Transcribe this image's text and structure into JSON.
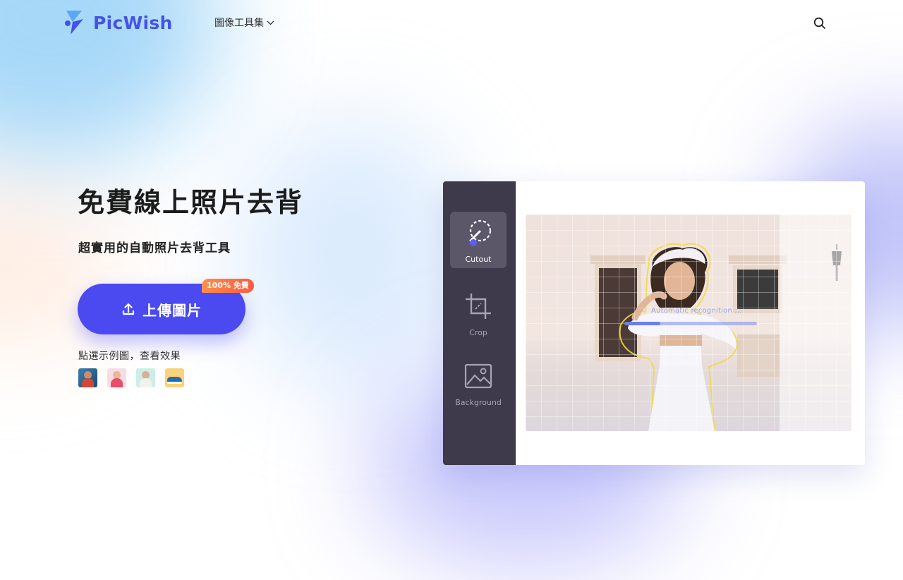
{
  "brand": {
    "name": "PicWish",
    "color": "#4352e8"
  },
  "nav": {
    "menu_label": "圖像工具集"
  },
  "hero": {
    "title": "免費線上照片去背",
    "subtitle": "超實用的自動照片去背工具",
    "upload_label": "上傳圖片",
    "badge": "100% 免費",
    "sample_label": "點選示例圖，查看效果",
    "samples": [
      "sample-portrait-1",
      "sample-portrait-2",
      "sample-portrait-3",
      "sample-shoe"
    ]
  },
  "editor": {
    "tools": [
      {
        "label": "Cutout",
        "icon": "cutout-icon",
        "active": true
      },
      {
        "label": "Crop",
        "icon": "crop-icon",
        "active": false
      },
      {
        "label": "Background",
        "icon": "background-image-icon",
        "active": false
      }
    ],
    "progress": {
      "label": "Automatic recognition ...",
      "value": 0.27
    }
  },
  "colors": {
    "primary": "#4a4af0",
    "badge": "#ff6a3d",
    "sidebar": "#3e3a4c"
  }
}
